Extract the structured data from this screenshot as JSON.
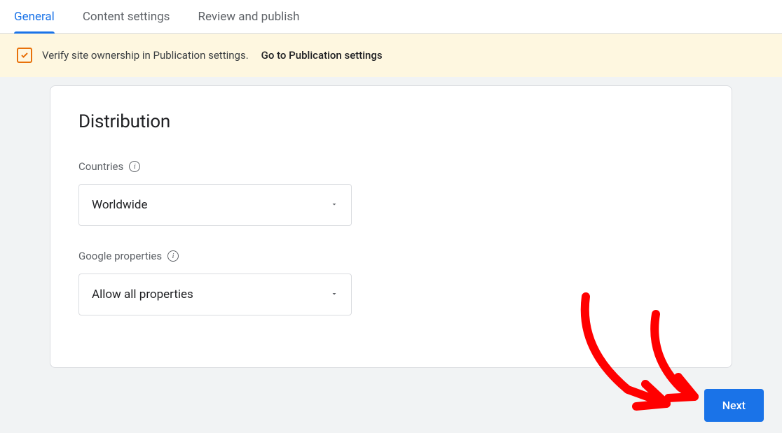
{
  "tabs": [
    {
      "label": "General",
      "active": true
    },
    {
      "label": "Content settings",
      "active": false
    },
    {
      "label": "Review and publish",
      "active": false
    }
  ],
  "banner": {
    "text": "Verify site ownership in Publication settings.",
    "link": "Go to Publication settings"
  },
  "card": {
    "title": "Distribution",
    "fields": {
      "countries": {
        "label": "Countries",
        "value": "Worldwide"
      },
      "properties": {
        "label": "Google properties",
        "value": "Allow all properties"
      }
    }
  },
  "buttons": {
    "next": "Next"
  }
}
